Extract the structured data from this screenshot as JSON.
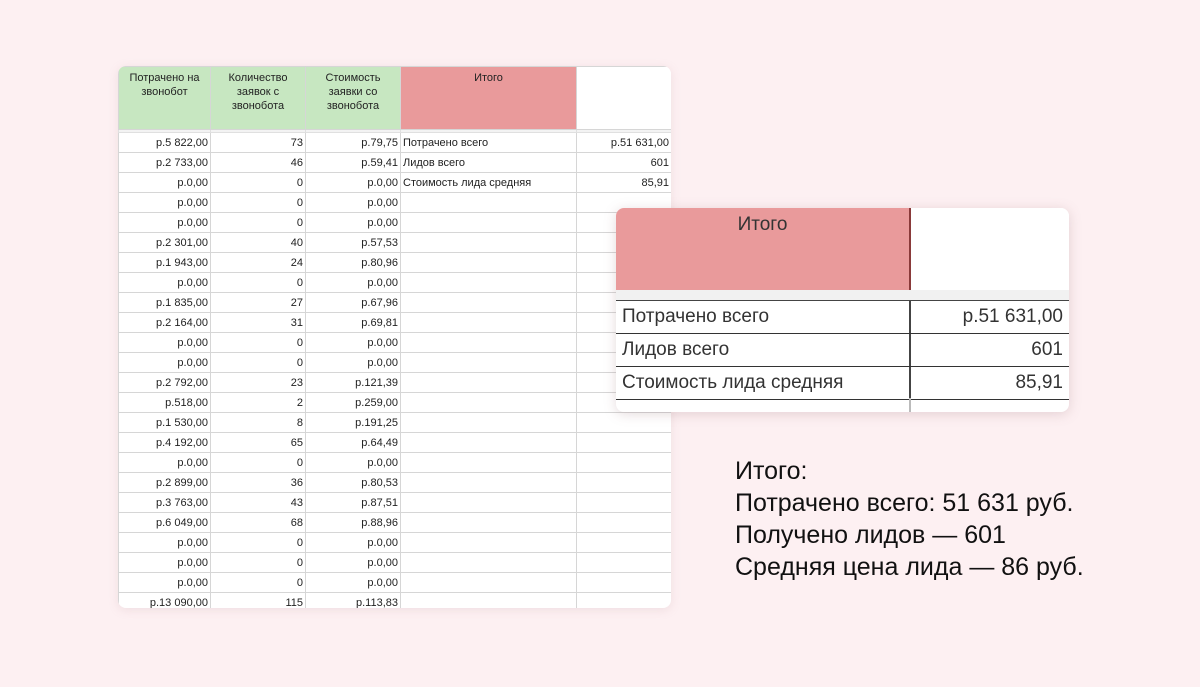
{
  "sheet": {
    "headers": {
      "spent": "Потрачено на звонобот",
      "count": "Количество заявок с звонобота",
      "cost": "Стоимость заявки со звонобота",
      "total": "Итого"
    },
    "rows": [
      {
        "spent": "р.5 822,00",
        "count": "73",
        "cost": "р.79,75",
        "label": "Потрачено всего",
        "value": "р.51 631,00"
      },
      {
        "spent": "р.2 733,00",
        "count": "46",
        "cost": "р.59,41",
        "label": "Лидов всего",
        "value": "601"
      },
      {
        "spent": "р.0,00",
        "count": "0",
        "cost": "р.0,00",
        "label": "Стоимость лида средняя",
        "value": "85,91"
      },
      {
        "spent": "р.0,00",
        "count": "0",
        "cost": "р.0,00"
      },
      {
        "spent": "р.0,00",
        "count": "0",
        "cost": "р.0,00"
      },
      {
        "spent": "р.2 301,00",
        "count": "40",
        "cost": "р.57,53"
      },
      {
        "spent": "р.1 943,00",
        "count": "24",
        "cost": "р.80,96"
      },
      {
        "spent": "р.0,00",
        "count": "0",
        "cost": "р.0,00"
      },
      {
        "spent": "р.1 835,00",
        "count": "27",
        "cost": "р.67,96"
      },
      {
        "spent": "р.2 164,00",
        "count": "31",
        "cost": "р.69,81"
      },
      {
        "spent": "р.0,00",
        "count": "0",
        "cost": "р.0,00"
      },
      {
        "spent": "р.0,00",
        "count": "0",
        "cost": "р.0,00"
      },
      {
        "spent": "р.2 792,00",
        "count": "23",
        "cost": "р.121,39"
      },
      {
        "spent": "р.518,00",
        "count": "2",
        "cost": "р.259,00"
      },
      {
        "spent": "р.1 530,00",
        "count": "8",
        "cost": "р.191,25"
      },
      {
        "spent": "р.4 192,00",
        "count": "65",
        "cost": "р.64,49"
      },
      {
        "spent": "р.0,00",
        "count": "0",
        "cost": "р.0,00"
      },
      {
        "spent": "р.2 899,00",
        "count": "36",
        "cost": "р.80,53"
      },
      {
        "spent": "р.3 763,00",
        "count": "43",
        "cost": "р.87,51"
      },
      {
        "spent": "р.6 049,00",
        "count": "68",
        "cost": "р.88,96"
      },
      {
        "spent": "р.0,00",
        "count": "0",
        "cost": "р.0,00"
      },
      {
        "spent": "р.0,00",
        "count": "0",
        "cost": "р.0,00"
      },
      {
        "spent": "р.0,00",
        "count": "0",
        "cost": "р.0,00"
      },
      {
        "spent": "р.13 090,00",
        "count": "115",
        "cost": "р.113,83"
      }
    ]
  },
  "zoom": {
    "title": "Итого",
    "rows": [
      {
        "label": "Потрачено всего",
        "value": "р.51 631,00"
      },
      {
        "label": "Лидов всего",
        "value": "601"
      },
      {
        "label": "Стоимость лида средняя",
        "value": "85,91"
      }
    ]
  },
  "summary": {
    "line1": "Итого:",
    "line2": "Потрачено всего: 51 631 руб.",
    "line3": "Получено лидов — 601",
    "line4": "Средняя цена лида — 86 руб."
  },
  "colors": {
    "page_bg": "#fdf0f2",
    "header_green": "#c7e7c1",
    "header_pink": "#e99a9b"
  }
}
